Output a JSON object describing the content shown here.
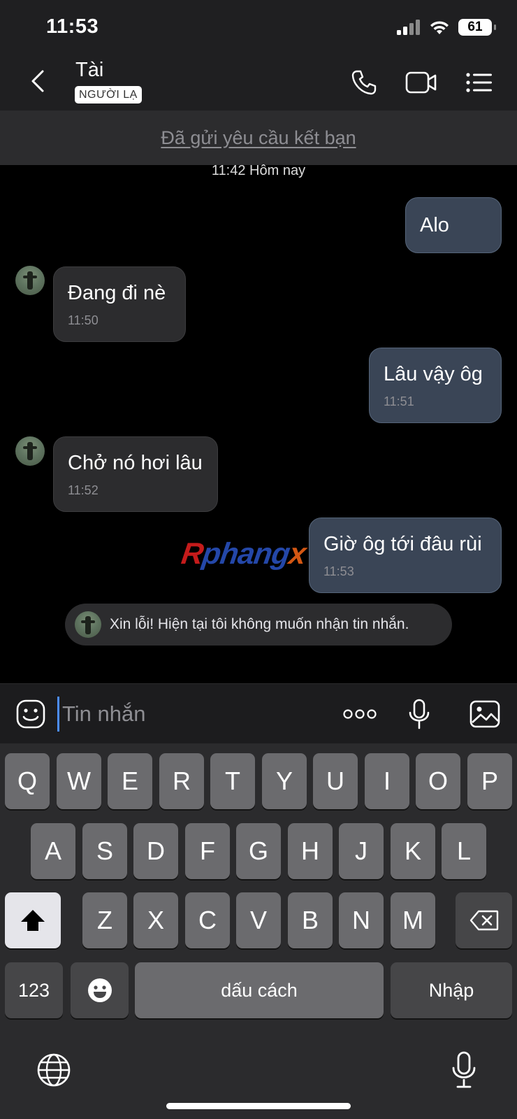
{
  "status_bar": {
    "time": "11:53",
    "battery": "61"
  },
  "header": {
    "contact_name": "Tài",
    "badge": "NGƯỜI LẠ"
  },
  "friend_request": {
    "text": "Đã gửi yêu cầu kết bạn"
  },
  "conversation": {
    "date_divider": "11:42 Hôm nay",
    "messages": [
      {
        "direction": "sent",
        "text": "Alo",
        "time": ""
      },
      {
        "direction": "received",
        "text": "Đang đi nè",
        "time": "11:50"
      },
      {
        "direction": "sent",
        "text": "Lâu vậy ôg",
        "time": "11:51"
      },
      {
        "direction": "received",
        "text": "Chở nó hơi lâu",
        "time": "11:52"
      },
      {
        "direction": "sent",
        "text": "Giờ ôg tới đâu rùi",
        "time": "11:53"
      }
    ],
    "system_notice": "Xin lỗi! Hiện tại tôi không muốn nhận tin nhắn."
  },
  "watermark": {
    "part1": "R",
    "part2": "phang",
    "part3": "x"
  },
  "composer": {
    "placeholder": "Tin nhắn",
    "value": ""
  },
  "keyboard": {
    "row1": [
      "Q",
      "W",
      "E",
      "R",
      "T",
      "Y",
      "U",
      "I",
      "O",
      "P"
    ],
    "row2": [
      "A",
      "S",
      "D",
      "F",
      "G",
      "H",
      "J",
      "K",
      "L"
    ],
    "row3": [
      "Z",
      "X",
      "C",
      "V",
      "B",
      "N",
      "M"
    ],
    "numbers_key": "123",
    "space_key": "dấu cách",
    "return_key": "Nhập"
  }
}
